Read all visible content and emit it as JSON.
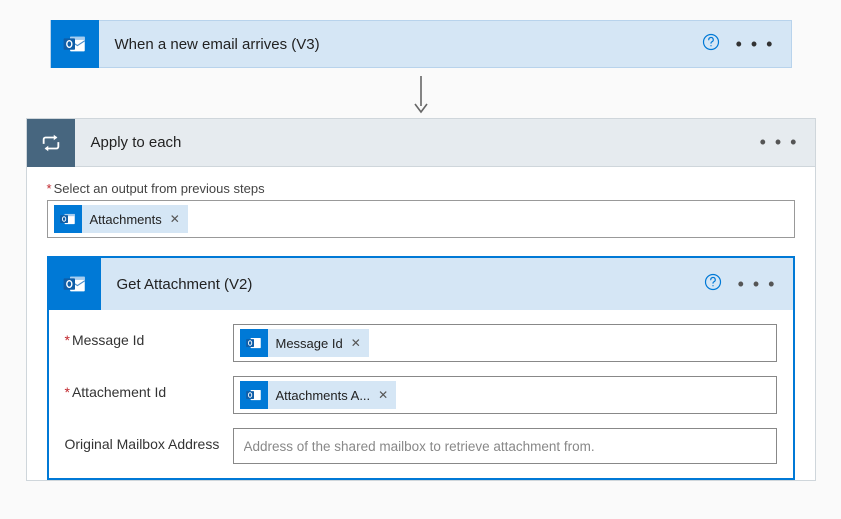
{
  "trigger": {
    "title": "When a new email arrives (V3)"
  },
  "applyToEach": {
    "title": "Apply to each",
    "selectOutputLabel": "Select an output from previous steps",
    "selectOutputToken": "Attachments"
  },
  "getAttachment": {
    "title": "Get Attachment (V2)",
    "params": {
      "messageId": {
        "label": "Message Id",
        "token": "Message Id"
      },
      "attachmentId": {
        "label": "Attachement Id",
        "token": "Attachments A..."
      },
      "originalMailbox": {
        "label": "Original Mailbox Address",
        "placeholder": "Address of the shared mailbox to retrieve attachment from."
      }
    }
  },
  "glyphs": {
    "close": "✕",
    "more": "• • •"
  }
}
